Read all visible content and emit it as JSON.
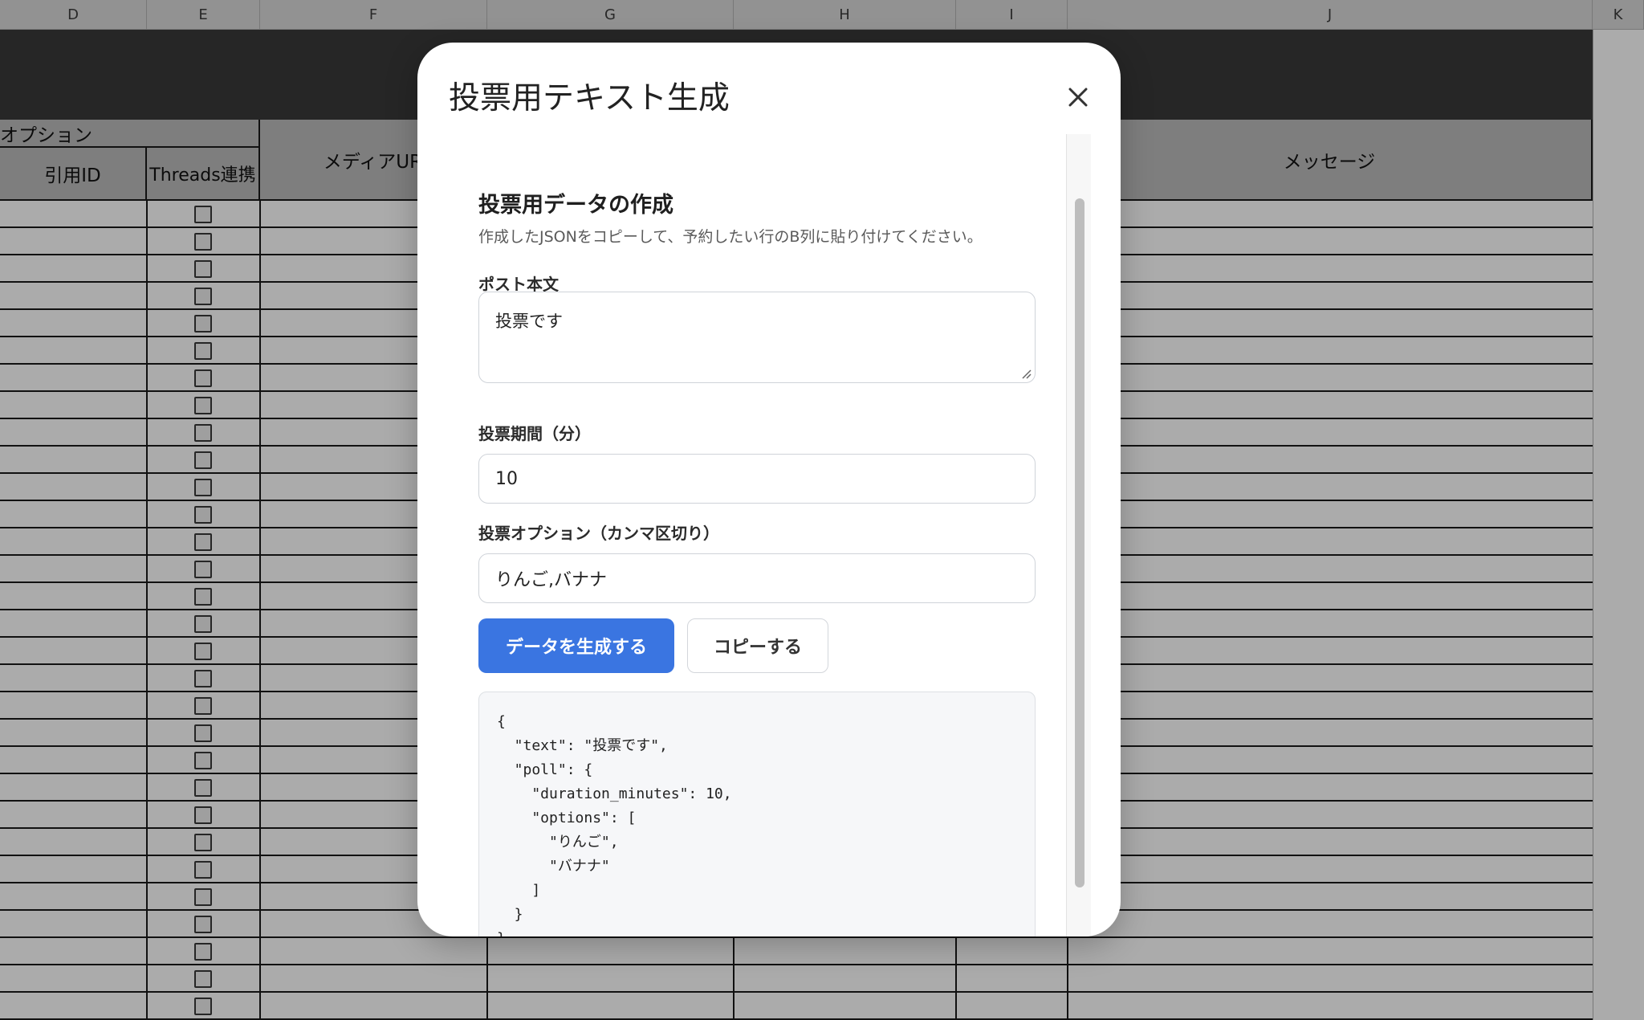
{
  "sheet": {
    "columns": [
      "D",
      "E",
      "F",
      "G",
      "H",
      "I",
      "J",
      "K"
    ],
    "option_group_label": "オプション",
    "headers": {
      "quote_id": "引用ID",
      "threads": "Threads連携",
      "media_url": "メディアUR",
      "message": "メッセージ"
    }
  },
  "modal": {
    "title": "投票用テキスト生成",
    "section_title": "投票用データの作成",
    "section_desc": "作成したJSONをコピーして、予約したい行のB列に貼り付けてください。",
    "post_label": "ポスト本文",
    "post_value": "投票です",
    "duration_label": "投票期間（分）",
    "duration_value": "10",
    "options_label": "投票オプション（カンマ区切り）",
    "options_value": "りんご,バナナ",
    "generate_label": "データを生成する",
    "copy_label": "コピーする",
    "json_output": "{\n  \"text\": \"投票です\",\n  \"poll\": {\n    \"duration_minutes\": 10,\n    \"options\": [\n      \"りんご\",\n      \"バナナ\"\n    ]\n  }\n}"
  },
  "colors": {
    "primary_button": "#3a75e1",
    "header_band": "#3a3a3a"
  },
  "icons": {
    "close": "close-icon",
    "checkbox": "checkbox-icon"
  }
}
